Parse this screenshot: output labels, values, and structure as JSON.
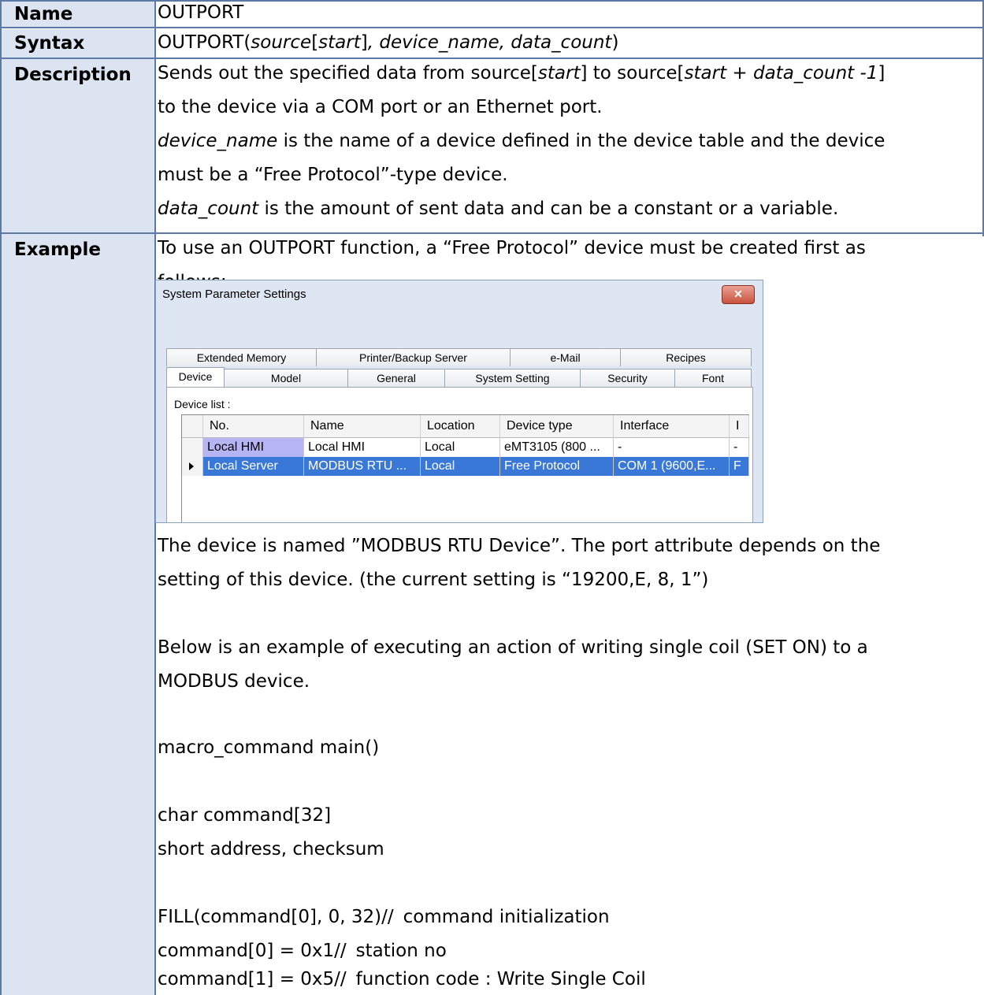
{
  "rows": {
    "name": {
      "label": "Name",
      "value": "OUTPORT"
    },
    "syntax": {
      "label": "Syntax",
      "prefix": "OUTPORT(",
      "arg_source": "source",
      "bracket_open": "[",
      "arg_start": "start",
      "bracket_close": "]",
      "rest": ", device_name, data_count",
      "suffix": ")"
    },
    "description": {
      "label": "Description",
      "line1_a": "Sends out the specified data from source[",
      "line1_b": "start",
      "line1_c": "] to source[",
      "line1_d": "start + data_count -1",
      "line1_e": "]",
      "line2": "to the device via a COM port or an Ethernet port.",
      "line3_a": "device_name",
      "line3_b": " is the name of a device defined in the device table and the device",
      "line4": "must be a “Free Protocol”-type device.",
      "line5_a": "data_count",
      "line5_b": " is the amount of sent data and can be a constant or a variable."
    },
    "example": {
      "label": "Example",
      "intro1": "To use an OUTPORT function, a “Free Protocol” device must be created first as",
      "intro2": "follows:",
      "after1": "The device is named ”MODBUS RTU Device”. The port attribute depends on the",
      "after2": "setting of this device. (the current setting is “19200,E, 8, 1”)",
      "para1": "Below is an example of executing an action of writing single coil (SET ON) to a",
      "para2": "MODBUS device.",
      "code": [
        {
          "code": "macro_command main()",
          "comment": ""
        },
        {
          "code": "char command[32]",
          "comment": ""
        },
        {
          "code": "short address, checksum",
          "comment": ""
        },
        {
          "code": "FILL(command[0], 0, 32)//",
          "comment": "command initialization"
        },
        {
          "code": "command[0] = 0x1//",
          "comment": "station no"
        },
        {
          "code": "command[1] = 0x5//",
          "comment": "function code : Write Single Coil"
        }
      ]
    }
  },
  "dialog": {
    "title": "System Parameter Settings",
    "close_glyph": "✕",
    "tabs_row1": [
      "Extended Memory",
      "Printer/Backup Server",
      "e-Mail",
      "Recipes"
    ],
    "tabs_row2": [
      "Device",
      "Model",
      "General",
      "System Setting",
      "Security",
      "Font"
    ],
    "device_list_label": "Device list :",
    "columns": [
      "No.",
      "Name",
      "Location",
      "Device type",
      "Interface",
      "I"
    ],
    "devices": [
      {
        "no": "Local HMI",
        "name": "Local HMI",
        "location": "Local",
        "type": "eMT3105 (800 ...",
        "interface": "-",
        "extra": "-"
      },
      {
        "no": "Local Server",
        "name": "MODBUS RTU ...",
        "location": "Local",
        "type": "Free Protocol",
        "interface": "COM 1 (9600,E...",
        "extra": "F"
      }
    ]
  }
}
